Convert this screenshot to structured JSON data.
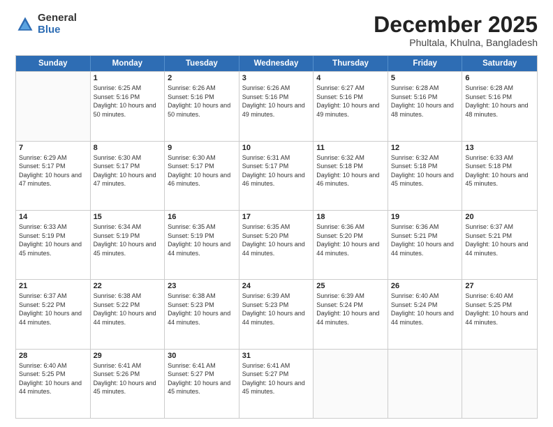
{
  "logo": {
    "general": "General",
    "blue": "Blue"
  },
  "title": {
    "month": "December 2025",
    "location": "Phultala, Khulna, Bangladesh"
  },
  "calendar": {
    "headers": [
      "Sunday",
      "Monday",
      "Tuesday",
      "Wednesday",
      "Thursday",
      "Friday",
      "Saturday"
    ],
    "weeks": [
      [
        {
          "day": "",
          "sunrise": "",
          "sunset": "",
          "daylight": ""
        },
        {
          "day": "1",
          "sunrise": "Sunrise: 6:25 AM",
          "sunset": "Sunset: 5:16 PM",
          "daylight": "Daylight: 10 hours and 50 minutes."
        },
        {
          "day": "2",
          "sunrise": "Sunrise: 6:26 AM",
          "sunset": "Sunset: 5:16 PM",
          "daylight": "Daylight: 10 hours and 50 minutes."
        },
        {
          "day": "3",
          "sunrise": "Sunrise: 6:26 AM",
          "sunset": "Sunset: 5:16 PM",
          "daylight": "Daylight: 10 hours and 49 minutes."
        },
        {
          "day": "4",
          "sunrise": "Sunrise: 6:27 AM",
          "sunset": "Sunset: 5:16 PM",
          "daylight": "Daylight: 10 hours and 49 minutes."
        },
        {
          "day": "5",
          "sunrise": "Sunrise: 6:28 AM",
          "sunset": "Sunset: 5:16 PM",
          "daylight": "Daylight: 10 hours and 48 minutes."
        },
        {
          "day": "6",
          "sunrise": "Sunrise: 6:28 AM",
          "sunset": "Sunset: 5:16 PM",
          "daylight": "Daylight: 10 hours and 48 minutes."
        }
      ],
      [
        {
          "day": "7",
          "sunrise": "Sunrise: 6:29 AM",
          "sunset": "Sunset: 5:17 PM",
          "daylight": "Daylight: 10 hours and 47 minutes."
        },
        {
          "day": "8",
          "sunrise": "Sunrise: 6:30 AM",
          "sunset": "Sunset: 5:17 PM",
          "daylight": "Daylight: 10 hours and 47 minutes."
        },
        {
          "day": "9",
          "sunrise": "Sunrise: 6:30 AM",
          "sunset": "Sunset: 5:17 PM",
          "daylight": "Daylight: 10 hours and 46 minutes."
        },
        {
          "day": "10",
          "sunrise": "Sunrise: 6:31 AM",
          "sunset": "Sunset: 5:17 PM",
          "daylight": "Daylight: 10 hours and 46 minutes."
        },
        {
          "day": "11",
          "sunrise": "Sunrise: 6:32 AM",
          "sunset": "Sunset: 5:18 PM",
          "daylight": "Daylight: 10 hours and 46 minutes."
        },
        {
          "day": "12",
          "sunrise": "Sunrise: 6:32 AM",
          "sunset": "Sunset: 5:18 PM",
          "daylight": "Daylight: 10 hours and 45 minutes."
        },
        {
          "day": "13",
          "sunrise": "Sunrise: 6:33 AM",
          "sunset": "Sunset: 5:18 PM",
          "daylight": "Daylight: 10 hours and 45 minutes."
        }
      ],
      [
        {
          "day": "14",
          "sunrise": "Sunrise: 6:33 AM",
          "sunset": "Sunset: 5:19 PM",
          "daylight": "Daylight: 10 hours and 45 minutes."
        },
        {
          "day": "15",
          "sunrise": "Sunrise: 6:34 AM",
          "sunset": "Sunset: 5:19 PM",
          "daylight": "Daylight: 10 hours and 45 minutes."
        },
        {
          "day": "16",
          "sunrise": "Sunrise: 6:35 AM",
          "sunset": "Sunset: 5:19 PM",
          "daylight": "Daylight: 10 hours and 44 minutes."
        },
        {
          "day": "17",
          "sunrise": "Sunrise: 6:35 AM",
          "sunset": "Sunset: 5:20 PM",
          "daylight": "Daylight: 10 hours and 44 minutes."
        },
        {
          "day": "18",
          "sunrise": "Sunrise: 6:36 AM",
          "sunset": "Sunset: 5:20 PM",
          "daylight": "Daylight: 10 hours and 44 minutes."
        },
        {
          "day": "19",
          "sunrise": "Sunrise: 6:36 AM",
          "sunset": "Sunset: 5:21 PM",
          "daylight": "Daylight: 10 hours and 44 minutes."
        },
        {
          "day": "20",
          "sunrise": "Sunrise: 6:37 AM",
          "sunset": "Sunset: 5:21 PM",
          "daylight": "Daylight: 10 hours and 44 minutes."
        }
      ],
      [
        {
          "day": "21",
          "sunrise": "Sunrise: 6:37 AM",
          "sunset": "Sunset: 5:22 PM",
          "daylight": "Daylight: 10 hours and 44 minutes."
        },
        {
          "day": "22",
          "sunrise": "Sunrise: 6:38 AM",
          "sunset": "Sunset: 5:22 PM",
          "daylight": "Daylight: 10 hours and 44 minutes."
        },
        {
          "day": "23",
          "sunrise": "Sunrise: 6:38 AM",
          "sunset": "Sunset: 5:23 PM",
          "daylight": "Daylight: 10 hours and 44 minutes."
        },
        {
          "day": "24",
          "sunrise": "Sunrise: 6:39 AM",
          "sunset": "Sunset: 5:23 PM",
          "daylight": "Daylight: 10 hours and 44 minutes."
        },
        {
          "day": "25",
          "sunrise": "Sunrise: 6:39 AM",
          "sunset": "Sunset: 5:24 PM",
          "daylight": "Daylight: 10 hours and 44 minutes."
        },
        {
          "day": "26",
          "sunrise": "Sunrise: 6:40 AM",
          "sunset": "Sunset: 5:24 PM",
          "daylight": "Daylight: 10 hours and 44 minutes."
        },
        {
          "day": "27",
          "sunrise": "Sunrise: 6:40 AM",
          "sunset": "Sunset: 5:25 PM",
          "daylight": "Daylight: 10 hours and 44 minutes."
        }
      ],
      [
        {
          "day": "28",
          "sunrise": "Sunrise: 6:40 AM",
          "sunset": "Sunset: 5:25 PM",
          "daylight": "Daylight: 10 hours and 44 minutes."
        },
        {
          "day": "29",
          "sunrise": "Sunrise: 6:41 AM",
          "sunset": "Sunset: 5:26 PM",
          "daylight": "Daylight: 10 hours and 45 minutes."
        },
        {
          "day": "30",
          "sunrise": "Sunrise: 6:41 AM",
          "sunset": "Sunset: 5:27 PM",
          "daylight": "Daylight: 10 hours and 45 minutes."
        },
        {
          "day": "31",
          "sunrise": "Sunrise: 6:41 AM",
          "sunset": "Sunset: 5:27 PM",
          "daylight": "Daylight: 10 hours and 45 minutes."
        },
        {
          "day": "",
          "sunrise": "",
          "sunset": "",
          "daylight": ""
        },
        {
          "day": "",
          "sunrise": "",
          "sunset": "",
          "daylight": ""
        },
        {
          "day": "",
          "sunrise": "",
          "sunset": "",
          "daylight": ""
        }
      ]
    ]
  }
}
